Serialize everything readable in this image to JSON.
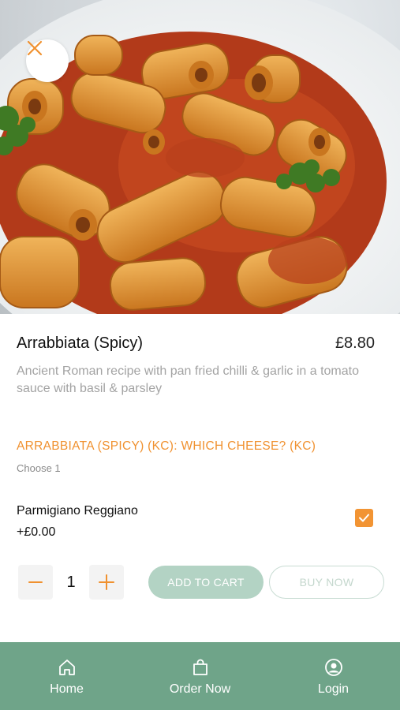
{
  "product": {
    "name": "Arrabbiata (Spicy)",
    "price": "£8.80",
    "description": "Ancient Roman recipe with pan fried chilli & garlic in a tomato sauce with basil & parsley",
    "image_icon": "pasta-photo"
  },
  "options": {
    "heading": "ARRABBIATA (SPICY) (KC): WHICH CHEESE? (KC)",
    "instruction": "Choose 1",
    "items": [
      {
        "name": "Parmigiano Reggiano",
        "price": "+£0.00",
        "checked": true
      }
    ]
  },
  "quantity": {
    "value": "1",
    "minus_icon": "minus-icon",
    "plus_icon": "plus-icon"
  },
  "actions": {
    "add_to_cart": "ADD TO CART",
    "buy_now": "BUY NOW"
  },
  "nav": {
    "items": [
      {
        "label": "Home",
        "icon": "home-icon"
      },
      {
        "label": "Order Now",
        "icon": "bag-icon"
      },
      {
        "label": "Login",
        "icon": "user-icon"
      }
    ]
  },
  "colors": {
    "accent": "#f29433",
    "brand_green": "#6fa489",
    "button_disabled": "#b3d3c4"
  }
}
